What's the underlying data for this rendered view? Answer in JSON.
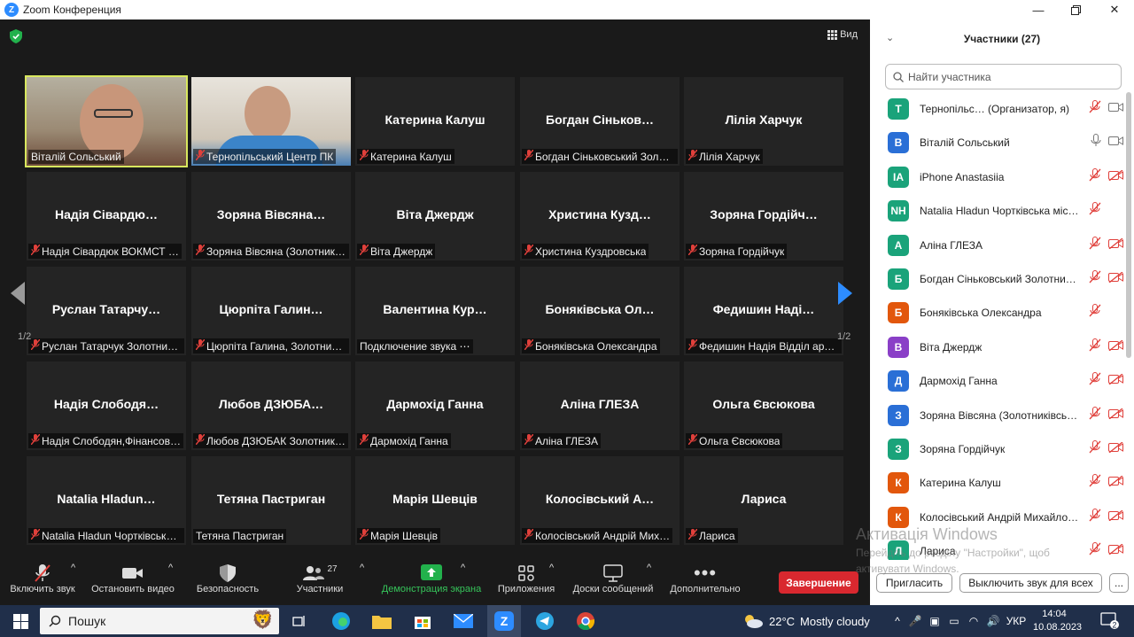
{
  "window": {
    "title": "Zoom Конференция",
    "controls": [
      "minimize",
      "maximize",
      "close"
    ]
  },
  "video": {
    "view_label": "Вид",
    "page_indicator_left": "1/2",
    "page_indicator_right": "1/2",
    "tiles": [
      {
        "big": "",
        "label": "Віталій Сольський",
        "muted": false,
        "camera": "cam1",
        "active": true
      },
      {
        "big": "",
        "label": "Тернопільський Центр ПК",
        "muted": true,
        "camera": "cam2"
      },
      {
        "big": "Катерина Калуш",
        "label": "Катерина Калуш",
        "muted": true
      },
      {
        "big": "Богдан Сіньков…",
        "label": "Богдан Сіньковський Золо…",
        "muted": true
      },
      {
        "big": "Лілія Харчук",
        "label": "Лілія Харчук",
        "muted": true
      },
      {
        "big": "Надія Сівардю…",
        "label": "Надія Сівардюк ВОКМСТ …",
        "muted": true
      },
      {
        "big": "Зоряна Вівсяна…",
        "label": "Зоряна Вівсяна (Золотникі…",
        "muted": true
      },
      {
        "big": "Віта Джердж",
        "label": "Віта Джердж",
        "muted": true
      },
      {
        "big": "Христина Кузд…",
        "label": "Христина Куздровська",
        "muted": true
      },
      {
        "big": "Зоряна Гордійч…",
        "label": "Зоряна Гордійчук",
        "muted": true
      },
      {
        "big": "Руслан Татарчу…",
        "label": "Руслан Татарчук Золотник…",
        "muted": true
      },
      {
        "big": "Цюрпіта Галин…",
        "label": "Цюрпіта Галина, Золотник…",
        "muted": true
      },
      {
        "big": "Валентина Кур…",
        "label": "Подключение звука ⋯",
        "muted": false
      },
      {
        "big": "Боняківська Ол…",
        "label": "Боняківська Олександра",
        "muted": true
      },
      {
        "big": "Федишин Наді…",
        "label": "Федишин Надія Відділ арх…",
        "muted": true
      },
      {
        "big": "Надія Слободя…",
        "label": "Надія Слободян,Фінансов…",
        "muted": true
      },
      {
        "big": "Любов ДЗЮБА…",
        "label": "Любов ДЗЮБАК Золотник…",
        "muted": true
      },
      {
        "big": "Дармохід Ганна",
        "label": "Дармохід Ганна",
        "muted": true
      },
      {
        "big": "Аліна ГЛЕЗА",
        "label": "Аліна ГЛЕЗА",
        "muted": true
      },
      {
        "big": "Ольга Євсюкова",
        "label": "Ольга Євсюкова",
        "muted": true
      },
      {
        "big": "Natalia Hladun…",
        "label": "Natalia Hladun Чортківська…",
        "muted": true
      },
      {
        "big": "Тетяна Пастриган",
        "label": "Тетяна Пастриган",
        "muted": false
      },
      {
        "big": "Марія Шевців",
        "label": "Марія Шевців",
        "muted": true
      },
      {
        "big": "Колосівський А…",
        "label": "Колосівський Андрій Мих…",
        "muted": true
      },
      {
        "big": "Лариса",
        "label": "Лариса",
        "muted": true
      }
    ]
  },
  "toolbar": {
    "unmute": "Включить звук",
    "stop_video": "Остановить видео",
    "security": "Безопасность",
    "participants": "Участники",
    "participants_count": "27",
    "share_screen": "Демонстрация экрана",
    "apps": "Приложения",
    "whiteboards": "Доски сообщений",
    "more": "Дополнительно",
    "end": "Завершение"
  },
  "panel": {
    "title": "Участники (27)",
    "search_placeholder": "Найти участника",
    "participants": [
      {
        "initials": "T",
        "name": "Тернопільс… (Организатор, я)",
        "color": "#1aa37a",
        "mic": "off",
        "cam": "on"
      },
      {
        "initials": "B",
        "name": "Віталій Сольський",
        "color": "#2a6fd6",
        "mic": "on",
        "cam": "on"
      },
      {
        "initials": "IA",
        "name": "iPhone Anastasiia",
        "color": "#1aa37a",
        "mic": "off",
        "cam": "off"
      },
      {
        "initials": "NH",
        "name": "Natalia Hladun Чортківська міська …",
        "color": "#1aa37a",
        "mic": "off",
        "cam": "none"
      },
      {
        "initials": "A",
        "name": "Аліна ГЛЕЗА",
        "color": "#1aa37a",
        "mic": "off",
        "cam": "off"
      },
      {
        "initials": "Б",
        "name": "Богдан Сіньковський Золотни…",
        "color": "#1aa37a",
        "mic": "off",
        "cam": "off"
      },
      {
        "initials": "Б",
        "name": "Боняківська Олександра",
        "color": "#e2570c",
        "mic": "off",
        "cam": "none"
      },
      {
        "initials": "B",
        "name": "Віта Джердж",
        "color": "#8a3fc7",
        "mic": "off",
        "cam": "off"
      },
      {
        "initials": "Д",
        "name": "Дармохід Ганна",
        "color": "#2a6fd6",
        "mic": "off",
        "cam": "off"
      },
      {
        "initials": "З",
        "name": "Зоряна Вівсяна (Золотниківсь…",
        "color": "#2a6fd6",
        "mic": "off",
        "cam": "off"
      },
      {
        "initials": "З",
        "name": "Зоряна Гордійчук",
        "color": "#1aa37a",
        "mic": "off",
        "cam": "off"
      },
      {
        "initials": "К",
        "name": "Катерина Калуш",
        "color": "#e2570c",
        "mic": "off",
        "cam": "off"
      },
      {
        "initials": "К",
        "name": "Колосівський Андрій Михайло…",
        "color": "#e2570c",
        "mic": "off",
        "cam": "off"
      },
      {
        "initials": "Л",
        "name": "Лариса",
        "color": "#1aa37a",
        "mic": "off",
        "cam": "off"
      }
    ],
    "invite": "Пригласить",
    "mute_all": "Выключить звук для всех",
    "more": "..."
  },
  "watermark": {
    "line1": "Активація Windows",
    "line2": "Перейдіть до розділу \"Настройки\", щоб",
    "line3": "активувати Windows."
  },
  "taskbar": {
    "search_label": "Пошук",
    "weather_temp": "22°C",
    "weather_text": "Mostly cloudy",
    "lang": "УКР",
    "time": "14:04",
    "date": "10.08.2023",
    "notifications": "2"
  }
}
